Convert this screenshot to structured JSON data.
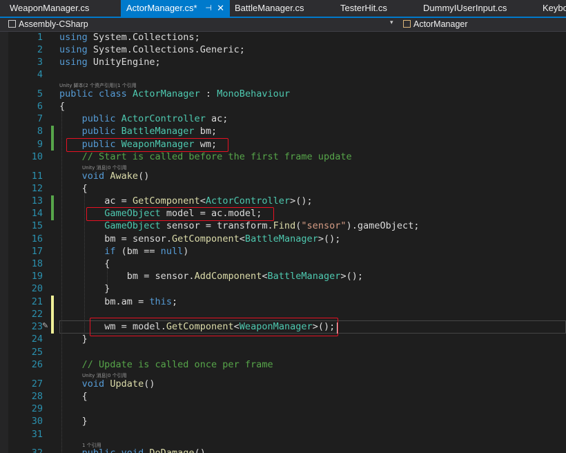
{
  "tabs": [
    {
      "label": "WeaponManager.cs"
    },
    {
      "label": "ActorManager.cs*",
      "pin": "⊣",
      "close": "✕"
    },
    {
      "label": "BattleManager.cs"
    },
    {
      "label": "TesterHit.cs"
    },
    {
      "label": "DummyIUserInput.cs"
    },
    {
      "label": "Keyboa"
    }
  ],
  "navbar": {
    "project": "Assembly-CSharp",
    "member": "ActorManager"
  },
  "lenses": {
    "class": "Unity 脚本(2 个资产引用)|1 个引用",
    "start": "Unity 消息|0 个引用",
    "update": "Unity 消息|0 个引用",
    "dodamage": "1 个引用"
  },
  "line_numbers": [
    "1",
    "2",
    "3",
    "4",
    "5",
    "6",
    "7",
    "8",
    "9",
    "10",
    "11",
    "12",
    "13",
    "14",
    "15",
    "16",
    "17",
    "18",
    "19",
    "20",
    "21",
    "22",
    "23",
    "24",
    "25",
    "26",
    "27",
    "28",
    "29",
    "30",
    "31",
    "32"
  ],
  "code": {
    "l1": [
      "using",
      "System.Collections;"
    ],
    "l2": [
      "using",
      "System.Collections.Generic;"
    ],
    "l3": [
      "using",
      "UnityEngine;"
    ],
    "l5": [
      "public",
      "class",
      "ActorManager",
      ":",
      "MonoBehaviour"
    ],
    "l6": [
      "{"
    ],
    "l7": [
      "public",
      "ActorController",
      "ac;"
    ],
    "l8": [
      "public",
      "BattleManager",
      "bm;"
    ],
    "l9": [
      "public",
      "WeaponManager",
      "wm;"
    ],
    "l10": [
      "// Start is called before the first frame update"
    ],
    "l11": [
      "void",
      "Awake",
      "()"
    ],
    "l12": [
      "{"
    ],
    "l13": [
      "ac = ",
      "GetComponent",
      "<",
      "ActorController",
      ">();"
    ],
    "l14": [
      "GameObject",
      "model",
      " = ac.model;"
    ],
    "l15": [
      "GameObject",
      "sensor",
      " = transform.",
      "Find",
      "(",
      "\"sensor\"",
      ").gameObject;"
    ],
    "l16": [
      "bm = ",
      "sensor",
      ".",
      "GetComponent",
      "<",
      "BattleManager",
      ">();"
    ],
    "l17": [
      "if",
      " (bm == ",
      "null",
      ")"
    ],
    "l18": [
      "{"
    ],
    "l19": [
      "bm = ",
      "sensor",
      ".",
      "AddComponent",
      "<",
      "BattleManager",
      ">();"
    ],
    "l20": [
      "}"
    ],
    "l21": [
      "bm.am = ",
      "this",
      ";"
    ],
    "l23": [
      "wm = ",
      "model",
      ".",
      "GetComponent",
      "<",
      "WeaponManager",
      ">();"
    ],
    "l24": [
      "}"
    ],
    "l26": [
      "// Update is called once per frame"
    ],
    "l27": [
      "void",
      "Update",
      "()"
    ],
    "l28": [
      "{"
    ],
    "l30": [
      "}"
    ],
    "l32": [
      "public",
      "void",
      "DoDamage",
      "()"
    ]
  },
  "colors": {
    "keyword": "#569cd6",
    "type": "#4ec9b0",
    "comment": "#57a64a",
    "string": "#d69d85",
    "method": "#dcdcaa",
    "highlight_box": "#e81123",
    "tab_active": "#007acc"
  },
  "icons": {
    "pencil": "✎",
    "dropdown": "▾"
  }
}
